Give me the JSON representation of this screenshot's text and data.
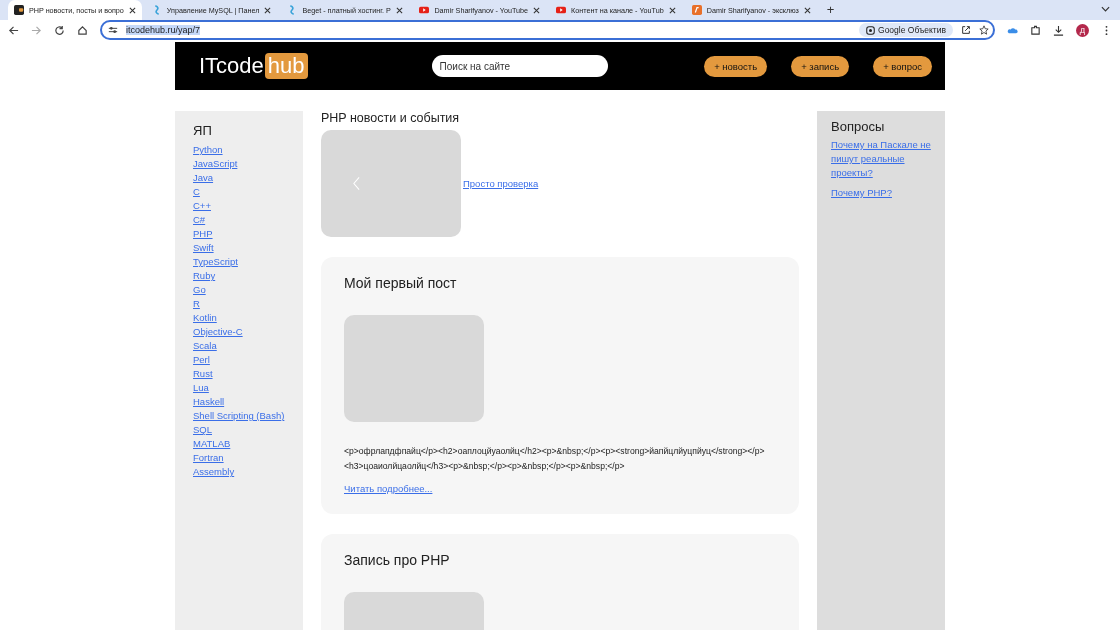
{
  "browser": {
    "tabs": [
      {
        "title": "PHP новости, посты и вопро",
        "selected": true,
        "kind": "site"
      },
      {
        "title": "Управление MySQL | Панел",
        "selected": false,
        "kind": "hosting"
      },
      {
        "title": "Beget - платный хостинг. Р",
        "selected": false,
        "kind": "hosting"
      },
      {
        "title": "Damir Sharifyanov - YouTube",
        "selected": false,
        "kind": "video"
      },
      {
        "title": "Контент на канале - YouTub",
        "selected": false,
        "kind": "video"
      },
      {
        "title": "Damir Sharifyanov - эксклюз",
        "selected": false,
        "kind": "brand"
      }
    ],
    "new_tab": "+",
    "url": {
      "text": "itcodehub.ru/yap/7",
      "selected": true
    },
    "lens_chip": "Google Объектив",
    "avatar": "Д"
  },
  "header": {
    "logo": {
      "part_1": "ITcode",
      "part_2": "hub"
    },
    "search": {
      "placeholder": "Поиск на сайте"
    },
    "buttons": [
      "+ новость",
      "+ запись",
      "+ вопрос"
    ]
  },
  "left_sidebar": {
    "title": "ЯП",
    "links": [
      "Python",
      "JavaScript",
      "Java",
      "C",
      "C++",
      "C#",
      "PHP",
      "Swift",
      "TypeScript",
      "Ruby",
      "Go",
      "R",
      "Kotlin",
      "Objective-C",
      "Scala",
      "Perl",
      "Rust",
      "Lua",
      "Haskell",
      "Shell Scripting (Bash)",
      "SQL",
      "MATLAB",
      "Fortran",
      "Assembly"
    ]
  },
  "main": {
    "title": "PHP новости и события",
    "slider": {
      "link": "Просто проверка"
    },
    "posts": [
      {
        "title": "Мой первый пост",
        "body": "<p>офрлапдфпайц</p><h2>оаплоцйуаолйц</h2><p>&nbsp;</p><p><strong>йапйцлйуцпйуц</strong></p><h3>цоаиолйцаолйц</h3><p>&nbsp;</p><p>&nbsp;</p><p>&nbsp;</p>",
        "more": "Читать подробнее..."
      },
      {
        "title": "Запись про PHP"
      }
    ]
  },
  "right_sidebar": {
    "title": "Вопросы",
    "links": [
      "Почему на Паскале не пишут реальные проекты?",
      "Почему PHP?"
    ]
  }
}
